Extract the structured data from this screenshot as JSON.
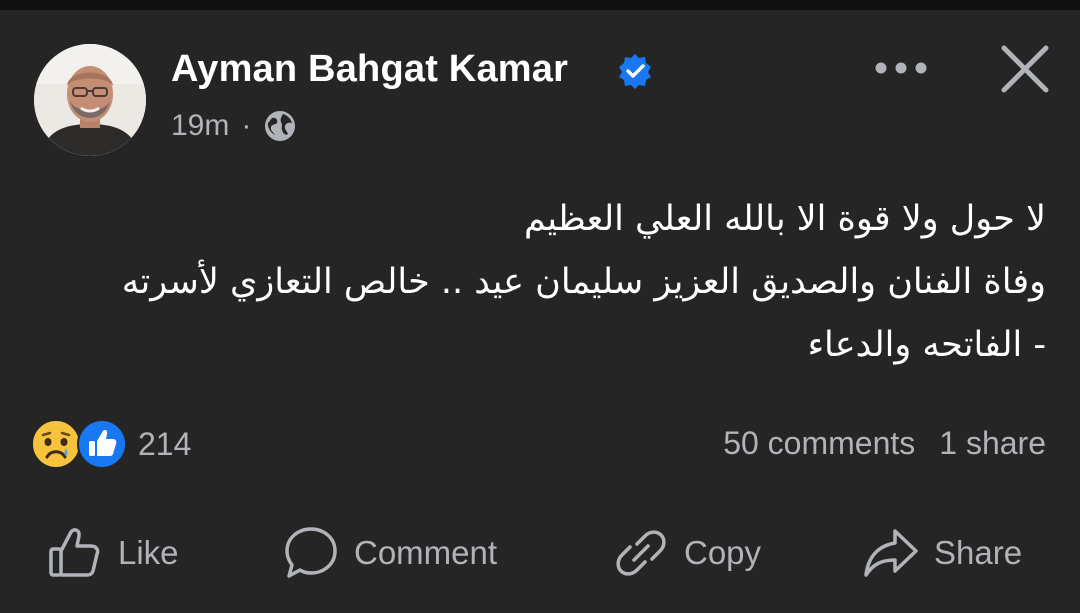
{
  "post": {
    "author": "Ayman Bahgat Kamar",
    "verified": true,
    "time": "19m",
    "separator": "·",
    "audience_icon": "globe-icon",
    "text_lines": [
      "لا حول ولا قوة الا بالله العلي العظيم",
      "وفاة الفنان والصديق العزيز سليمان عيد .. خالص التعازي لأسرته",
      "- الفاتحه والدعاء"
    ]
  },
  "header_controls": {
    "more_icon": "more-horizontal-icon",
    "close_icon": "close-icon"
  },
  "reactions": {
    "icons": [
      "sad-reaction-icon",
      "like-reaction-icon"
    ],
    "count": "214"
  },
  "stats": {
    "comments": "50 comments",
    "shares": "1 share"
  },
  "actions": {
    "like": "Like",
    "comment": "Comment",
    "copy": "Copy",
    "share": "Share"
  },
  "colors": {
    "background": "#252526",
    "primary_text": "#ffffff",
    "secondary_text": "#b0b3b8",
    "verified_blue": "#1877f2",
    "reaction_yellow": "#f7c23c"
  }
}
